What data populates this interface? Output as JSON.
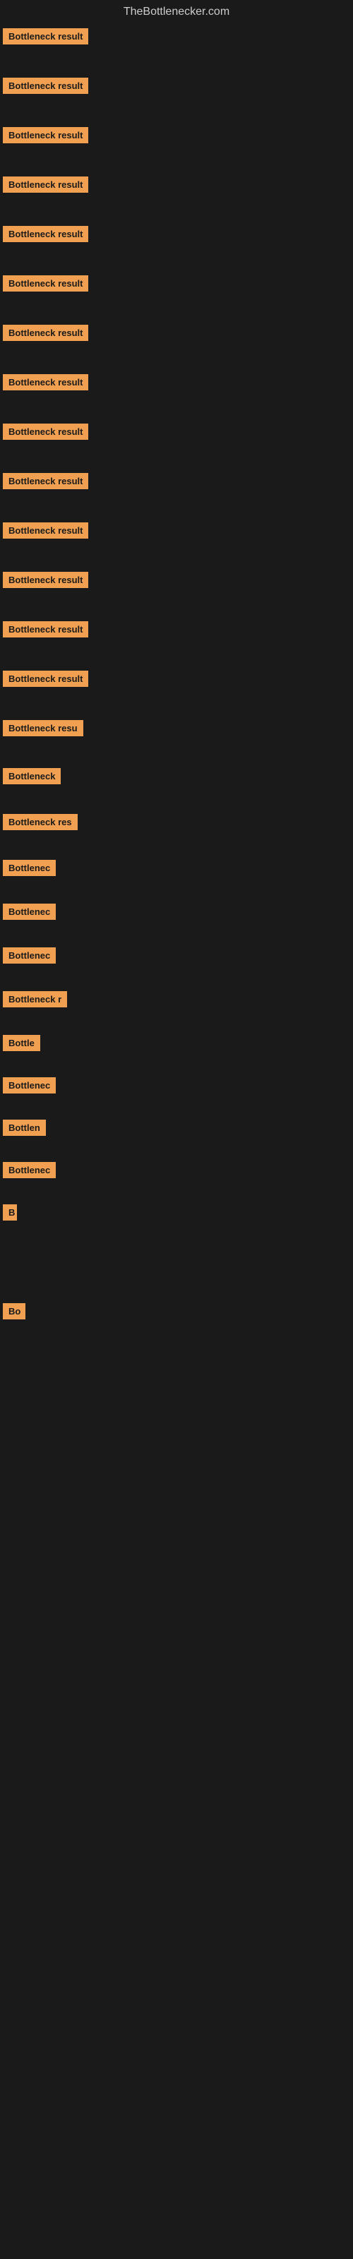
{
  "site": {
    "title": "TheBottlenecker.com"
  },
  "items": [
    {
      "id": 1,
      "label": "Bottleneck result"
    },
    {
      "id": 2,
      "label": "Bottleneck result"
    },
    {
      "id": 3,
      "label": "Bottleneck result"
    },
    {
      "id": 4,
      "label": "Bottleneck result"
    },
    {
      "id": 5,
      "label": "Bottleneck result"
    },
    {
      "id": 6,
      "label": "Bottleneck result"
    },
    {
      "id": 7,
      "label": "Bottleneck result"
    },
    {
      "id": 8,
      "label": "Bottleneck result"
    },
    {
      "id": 9,
      "label": "Bottleneck result"
    },
    {
      "id": 10,
      "label": "Bottleneck result"
    },
    {
      "id": 11,
      "label": "Bottleneck result"
    },
    {
      "id": 12,
      "label": "Bottleneck result"
    },
    {
      "id": 13,
      "label": "Bottleneck result"
    },
    {
      "id": 14,
      "label": "Bottleneck result"
    },
    {
      "id": 15,
      "label": "Bottleneck resu"
    },
    {
      "id": 16,
      "label": "Bottleneck"
    },
    {
      "id": 17,
      "label": "Bottleneck res"
    },
    {
      "id": 18,
      "label": "Bottlenec"
    },
    {
      "id": 19,
      "label": "Bottlenec"
    },
    {
      "id": 20,
      "label": "Bottlenec"
    },
    {
      "id": 21,
      "label": "Bottleneck r"
    },
    {
      "id": 22,
      "label": "Bottle"
    },
    {
      "id": 23,
      "label": "Bottlenec"
    },
    {
      "id": 24,
      "label": "Bottlen"
    },
    {
      "id": 25,
      "label": "Bottlenec"
    },
    {
      "id": 26,
      "label": "B"
    },
    {
      "id": 27,
      "label": ""
    },
    {
      "id": 28,
      "label": ""
    },
    {
      "id": 29,
      "label": ""
    },
    {
      "id": 30,
      "label": "Bo"
    },
    {
      "id": 31,
      "label": ""
    },
    {
      "id": 32,
      "label": ""
    },
    {
      "id": 33,
      "label": ""
    }
  ]
}
